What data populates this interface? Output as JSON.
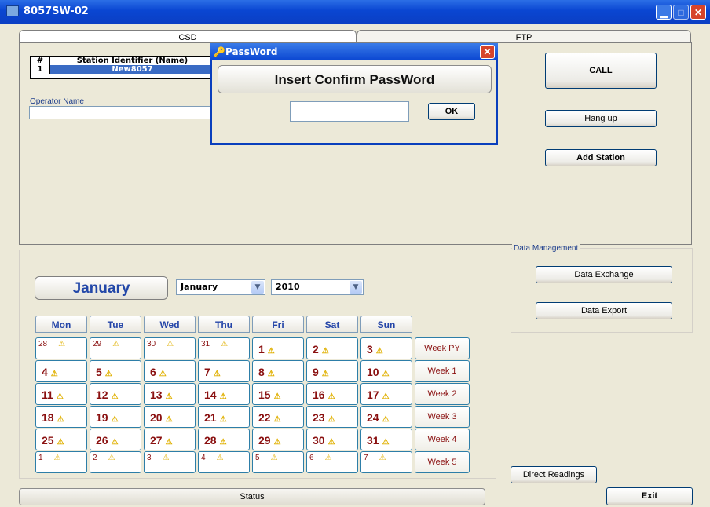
{
  "window": {
    "title": "8057SW-02"
  },
  "tabs": [
    "CSD",
    "FTP"
  ],
  "station_table": {
    "headers": [
      "#",
      "Station Identifier (Name)"
    ],
    "rows": [
      {
        "num": "1",
        "name": "New8057"
      }
    ]
  },
  "operator": {
    "label": "Operator Name",
    "value": ""
  },
  "buttons": {
    "call": "CALL",
    "hangup": "Hang up",
    "add_station": "Add Station",
    "data_exchange": "Data Exchange",
    "data_export": "Data Export",
    "direct_readings": "Direct Readings",
    "exit": "Exit"
  },
  "data_management": {
    "label": "Data Management"
  },
  "calendar": {
    "month_title": "January",
    "month_select": "January",
    "year_select": "2010",
    "days": [
      "Mon",
      "Tue",
      "Wed",
      "Thu",
      "Fri",
      "Sat",
      "Sun"
    ],
    "weeks": [
      {
        "label": "Week PY",
        "dates": [
          "28",
          "29",
          "30",
          "31",
          "1",
          "2",
          "3"
        ],
        "small": [
          true,
          true,
          true,
          true,
          false,
          false,
          false
        ]
      },
      {
        "label": "Week 1",
        "dates": [
          "4",
          "5",
          "6",
          "7",
          "8",
          "9",
          "10"
        ],
        "small": [
          false,
          false,
          false,
          false,
          false,
          false,
          false
        ]
      },
      {
        "label": "Week 2",
        "dates": [
          "11",
          "12",
          "13",
          "14",
          "15",
          "16",
          "17"
        ],
        "small": [
          false,
          false,
          false,
          false,
          false,
          false,
          false
        ]
      },
      {
        "label": "Week 3",
        "dates": [
          "18",
          "19",
          "20",
          "21",
          "22",
          "23",
          "24"
        ],
        "small": [
          false,
          false,
          false,
          false,
          false,
          false,
          false
        ]
      },
      {
        "label": "Week 4",
        "dates": [
          "25",
          "26",
          "27",
          "28",
          "29",
          "30",
          "31"
        ],
        "small": [
          false,
          false,
          false,
          false,
          false,
          false,
          false
        ]
      },
      {
        "label": "Week 5",
        "dates": [
          "1",
          "2",
          "3",
          "4",
          "5",
          "6",
          "7"
        ],
        "small": [
          true,
          true,
          true,
          true,
          true,
          true,
          true
        ]
      }
    ],
    "warn_icon": "warning-icon"
  },
  "status": {
    "text": "Status"
  },
  "dialog": {
    "title": "PassWord",
    "message": "Insert Confirm  PassWord",
    "ok": "OK",
    "password": ""
  },
  "colors": {
    "titlebar": "#0a46d2",
    "day_text": "#8a1010",
    "header_text": "#2445a8"
  }
}
